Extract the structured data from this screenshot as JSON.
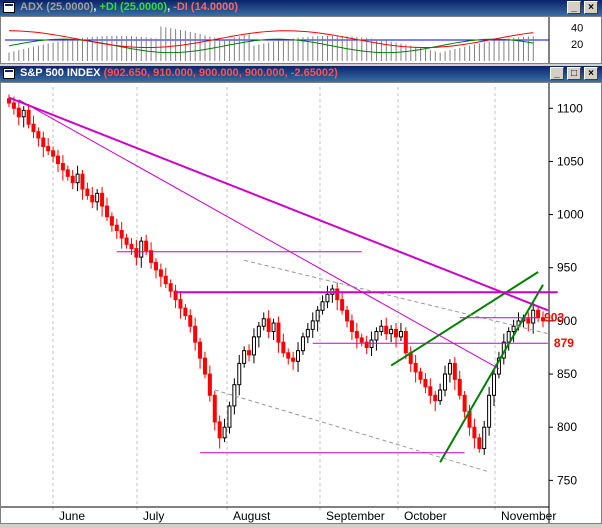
{
  "indicator_window": {
    "title": {
      "adx": "ADX (25.0000)",
      "sep1": ", ",
      "plus_di": "+DI (25.0000)",
      "sep2": ", ",
      "minus_di": "-DI (14.0000)"
    },
    "colors": {
      "adx": "#808080",
      "plus_di": "#008000",
      "minus_di": "#ff0000",
      "level": "#0000ff"
    },
    "ticks": [
      "40",
      "20"
    ]
  },
  "chart_window": {
    "title": {
      "symbol": "S&P 500 INDEX",
      "values": "(902.650, 910.000, 900.000, 900.000, -2.65002)"
    },
    "annotations": {
      "upper": "903",
      "lower": "879"
    },
    "buttons": {
      "minimize": "_",
      "restore": "□",
      "close": "×"
    }
  },
  "chart_data": {
    "type": "candlestick",
    "ylim": [
      740,
      1120
    ],
    "yticks": [
      {
        "value": 1100,
        "label": "1100"
      },
      {
        "value": 1050,
        "label": "1050"
      },
      {
        "value": 1000,
        "label": "1000"
      },
      {
        "value": 950,
        "label": "950"
      },
      {
        "value": 900,
        "label": "900"
      },
      {
        "value": 850,
        "label": "850"
      },
      {
        "value": 800,
        "label": "800"
      },
      {
        "value": 750,
        "label": "750"
      }
    ],
    "months": [
      "June",
      "July",
      "August",
      "September",
      "October",
      "November"
    ],
    "colors": {
      "up": "#000000",
      "down": "#ff0000",
      "resistance": "#cc00cc",
      "wedge": "#008000",
      "channel": "#999999"
    },
    "closes": [
      1105,
      1100,
      1092,
      1098,
      1085,
      1078,
      1072,
      1064,
      1060,
      1055,
      1048,
      1042,
      1036,
      1030,
      1038,
      1024,
      1018,
      1012,
      1020,
      1008,
      998,
      990,
      985,
      978,
      972,
      968,
      960,
      975,
      966,
      955,
      948,
      942,
      935,
      928,
      920,
      912,
      905,
      895,
      880,
      865,
      850,
      830,
      805,
      790,
      800,
      820,
      840,
      860,
      872,
      868,
      885,
      895,
      902,
      890,
      898,
      880,
      870,
      865,
      862,
      872,
      885,
      892,
      900,
      910,
      918,
      925,
      930,
      920,
      910,
      900,
      890,
      884,
      880,
      875,
      882,
      890,
      895,
      888,
      892,
      885,
      890,
      870,
      860,
      852,
      845,
      838,
      830,
      825,
      835,
      850,
      860,
      845,
      830,
      815,
      800,
      790,
      780,
      800,
      830,
      850,
      865,
      880,
      890,
      895,
      900,
      902,
      898,
      910,
      903,
      900
    ],
    "key_levels": [
      {
        "value": 965,
        "label": ""
      },
      {
        "value": 927,
        "label": ""
      },
      {
        "value": 903,
        "label": "903"
      },
      {
        "value": 879,
        "label": "879"
      },
      {
        "value": 776,
        "label": ""
      }
    ],
    "trendlines": [
      {
        "name": "downtrend",
        "from": {
          "x": 0,
          "y": 1110
        },
        "to": {
          "x": 110,
          "y": 910
        }
      },
      {
        "name": "wedge-upper",
        "from": {
          "x": 78,
          "y": 858
        },
        "to": {
          "x": 108,
          "y": 946
        }
      },
      {
        "name": "wedge-lower",
        "from": {
          "x": 88,
          "y": 767
        },
        "to": {
          "x": 109,
          "y": 934
        }
      }
    ]
  }
}
